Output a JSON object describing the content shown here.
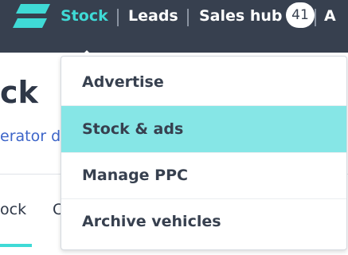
{
  "nav": {
    "items": [
      {
        "label": "Stock"
      },
      {
        "label": "Leads"
      },
      {
        "label": "Sales hub"
      },
      {
        "label": "A"
      }
    ],
    "sales_badge": "41",
    "accent": "#3fdad6",
    "bar_color": "#37404f"
  },
  "page": {
    "title": "ck",
    "subtitle_link": "erator do",
    "tabs": [
      {
        "label": "ock"
      },
      {
        "label": "C"
      }
    ]
  },
  "dropdown": {
    "items": [
      {
        "label": "Advertise"
      },
      {
        "label": "Stock & ads",
        "selected": true
      },
      {
        "label": "Manage PPC"
      },
      {
        "label": "Archive vehicles"
      }
    ],
    "highlight_color": "#86e6e6"
  }
}
